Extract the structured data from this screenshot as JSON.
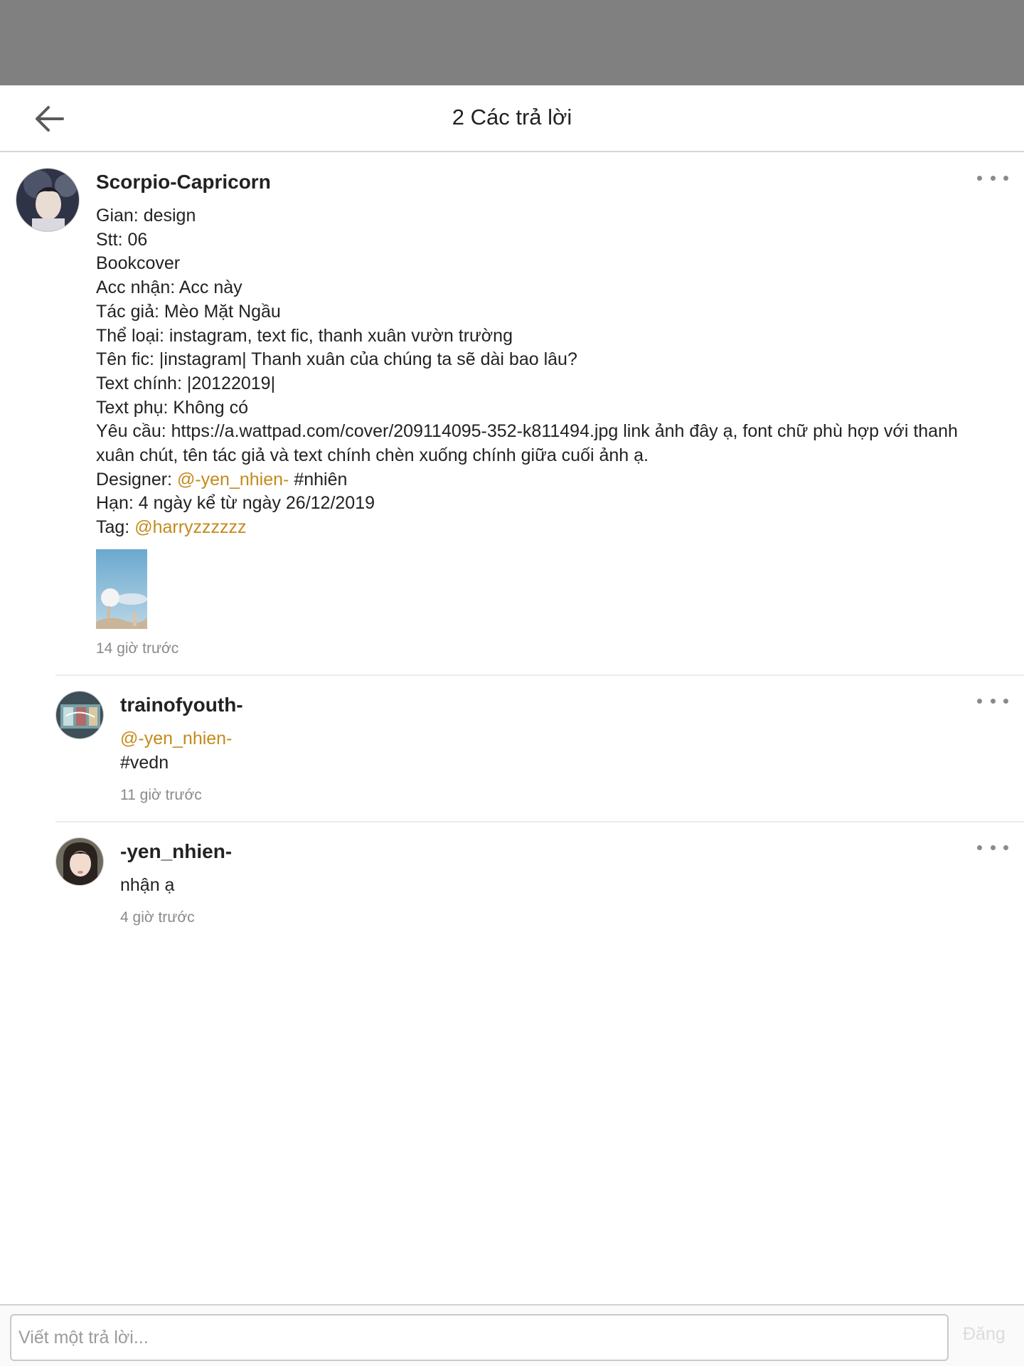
{
  "header": {
    "title": "2 Các trả lời",
    "back_icon": "arrow-left-icon"
  },
  "main_comment": {
    "username": "Scorpio-Capricorn",
    "lines": {
      "gian": "Gian: design",
      "stt": "Stt: 06",
      "bookcover": "Bookcover",
      "acc_nhan": "Acc nhận: Acc này",
      "tac_gia": "Tác giả: Mèo Mặt Ngầu",
      "the_loai": "Thể loại: instagram, text fic, thanh xuân vườn trường",
      "ten_fic": "Tên fic: |instagram| Thanh xuân của chúng ta sẽ dài bao lâu?",
      "text_chinh": "Text chính: |20122019|",
      "text_phu": "Text phụ: Không có",
      "yeu_cau": "Yêu cầu: https://a.wattpad.com/cover/209114095-352-k811494.jpg link ảnh đây ạ, font chữ phù hợp với thanh xuân chút, tên tác giả và text chính chèn xuống chính giữa cuối ảnh ạ.",
      "designer_prefix": "Designer:",
      "designer_mention": "@-yen_nhien-",
      "designer_suffix": "#nhiên",
      "han": "Hạn: 4 ngày kể từ ngày 26/12/2019",
      "tag_prefix": "Tag:",
      "tag_mention": "@harryzzzzzz"
    },
    "timestamp": "14 giờ trước"
  },
  "replies": [
    {
      "username": "trainofyouth-",
      "mention": "@-yen_nhien-",
      "text": "#vedn",
      "timestamp": "11 giờ trước"
    },
    {
      "username": "-yen_nhien-",
      "text": "nhận ạ",
      "timestamp": "4 giờ trước"
    }
  ],
  "composer": {
    "placeholder": "Viết một trả lời...",
    "post_label": "Đăng"
  },
  "colors": {
    "accent": "#c48a1c",
    "status_bar": "#808080",
    "muted": "#8a8a8a"
  }
}
